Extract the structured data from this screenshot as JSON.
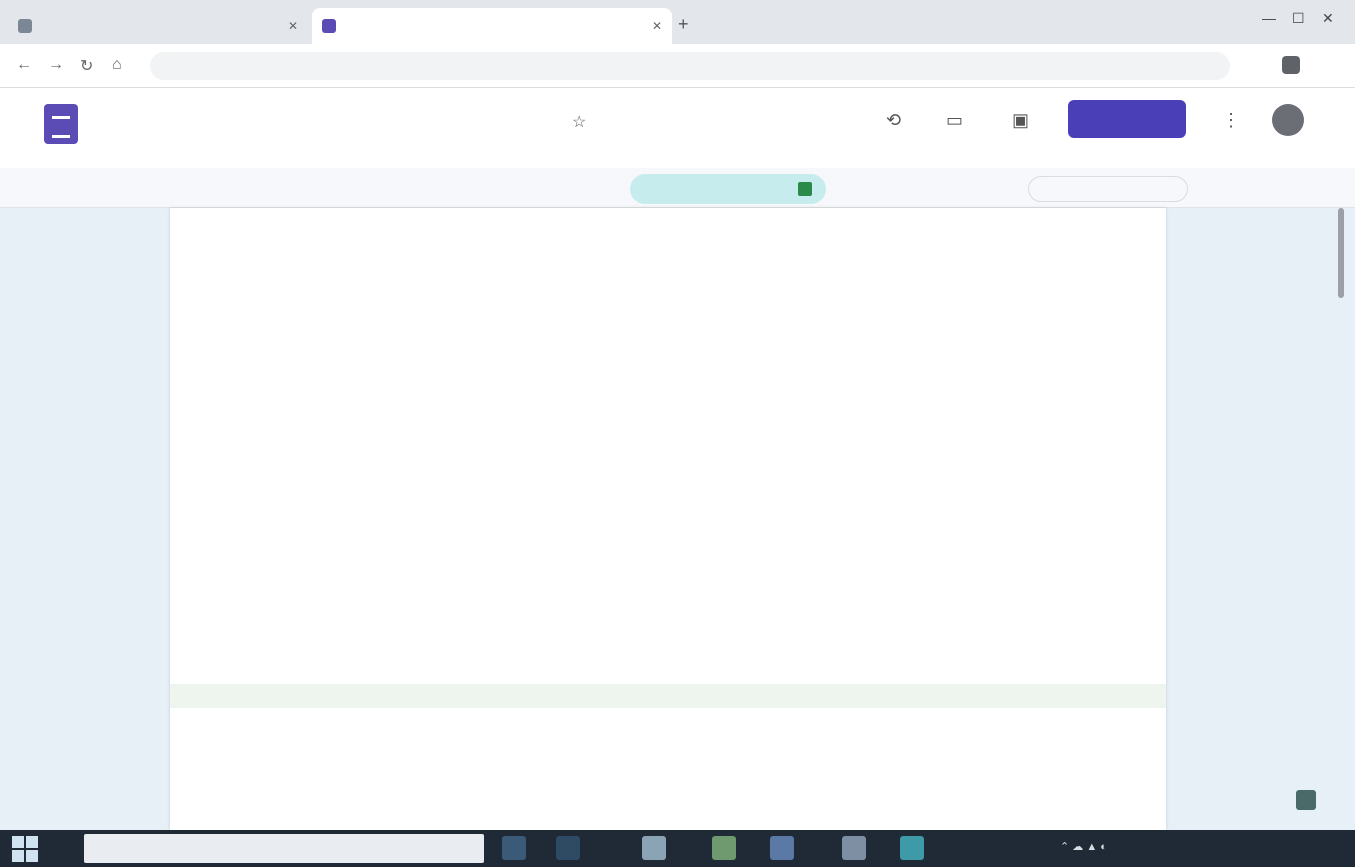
{
  "browser": {
    "tabs": [
      {
        "label": "",
        "active": false
      },
      {
        "label": "",
        "active": true
      }
    ],
    "url": "",
    "window_controls": [
      "—",
      "☐",
      "✕"
    ]
  },
  "docs": {
    "title": "",
    "share_label": "",
    "mode_label": "",
    "mode_value": "",
    "right_chip": ""
  },
  "document": {
    "heading": "",
    "meta": "",
    "section_label": "",
    "paragraph": "",
    "list_items": [
      "",
      "",
      ""
    ],
    "sub_label": "",
    "small_label": "",
    "heading2": "",
    "heading3": ""
  },
  "taskbar": {
    "search_placeholder": "",
    "clock_time": "",
    "clock_date": ""
  },
  "colors": {
    "docs_brand": "#5b4bb5",
    "share_button": "#4b3fb8",
    "mode_chip": "#c7ecee",
    "taskbar": "#1f2a36"
  },
  "icons": [
    "docs-logo-icon",
    "star-icon",
    "comment-icon",
    "history-icon",
    "meet-icon",
    "more-icon",
    "start-icon",
    "expand-icon"
  ]
}
